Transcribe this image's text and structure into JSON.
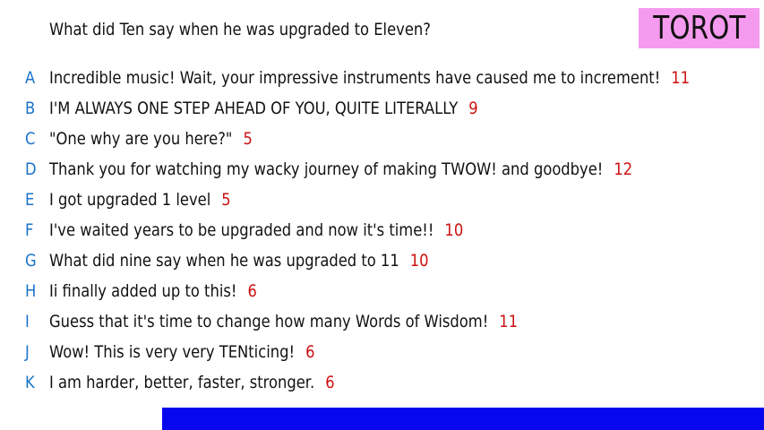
{
  "prompt": "What did Ten say when he was upgraded to Eleven?",
  "logo_text": "TOROT",
  "colors": {
    "letter": "#1a73c9",
    "count": "#cc1111",
    "logo_bg": "#f59bef",
    "bar": "#0707ee"
  },
  "responses": [
    {
      "letter": "A",
      "text": "Incredible music! Wait, your impressive instruments have caused me to increment!",
      "count": "11"
    },
    {
      "letter": "B",
      "text": "I'M ALWAYS ONE STEP AHEAD OF YOU, QUITE LITERALLY",
      "count": "9"
    },
    {
      "letter": "C",
      "text": "\"One why are you here?\"",
      "count": "5"
    },
    {
      "letter": "D",
      "text": "Thank you for watching my wacky journey of making TWOW! and goodbye!",
      "count": "12"
    },
    {
      "letter": "E",
      "text": "I got upgraded 1 level",
      "count": "5"
    },
    {
      "letter": "F",
      "text": "I've waited years to be upgraded and now it's time!!",
      "count": "10"
    },
    {
      "letter": "G",
      "text": "What did nine say when he was upgraded to 11",
      "count": "10"
    },
    {
      "letter": "H",
      "text": "Ii finally added up to this!",
      "count": "6"
    },
    {
      "letter": "I",
      "text": "Guess that it's time to change how many Words of Wisdom!",
      "count": "11"
    },
    {
      "letter": "J",
      "text": "Wow! This is very very TENticing!",
      "count": "6"
    },
    {
      "letter": "K",
      "text": "I am harder, better, faster, stronger.",
      "count": "6"
    }
  ]
}
